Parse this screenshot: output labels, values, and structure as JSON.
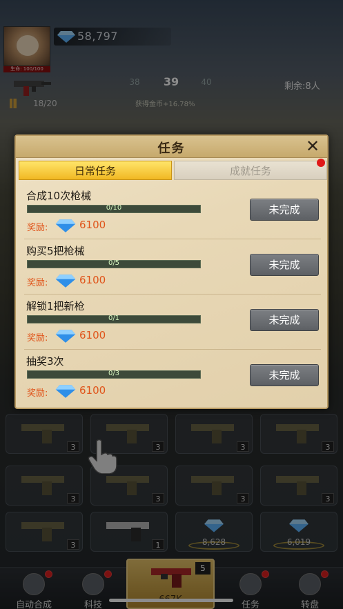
{
  "hud": {
    "gems": "58,797",
    "hp_label": "生命: 100/100",
    "ammo": "18/20",
    "level_prev": "38",
    "level_current": "39",
    "level_next": "40",
    "bonus": "获得金币+16.78%",
    "remaining": "剩余:8人"
  },
  "dialog": {
    "title": "任务",
    "close_label": "✕",
    "tabs": [
      {
        "label": "日常任务",
        "active": true
      },
      {
        "label": "成就任务",
        "active": false,
        "has_notification": true
      }
    ],
    "reward_label": "奖励:",
    "tasks": [
      {
        "title": "合成10次枪械",
        "progress_text": "0/10",
        "progress": 0,
        "reward": "6100",
        "status": "未完成"
      },
      {
        "title": "购买5把枪械",
        "progress_text": "0/5",
        "progress": 0,
        "reward": "6100",
        "status": "未完成"
      },
      {
        "title": "解锁1把新枪",
        "progress_text": "0/1",
        "progress": 0,
        "reward": "6100",
        "status": "未完成"
      },
      {
        "title": "抽奖3次",
        "progress_text": "0/3",
        "progress": 0,
        "reward": "6100",
        "status": "未完成"
      }
    ]
  },
  "grid": {
    "slot_levels": [
      "3",
      "3",
      "3",
      "3",
      "3",
      "3",
      "3",
      "3",
      "3",
      "1"
    ],
    "gem_slots": [
      "8,628",
      "6,019"
    ]
  },
  "bottom_nav": {
    "items": [
      {
        "label": "自动合成",
        "icon": "auto-merge-icon",
        "dot": true
      },
      {
        "label": "科技",
        "icon": "tech-icon",
        "dot": true
      },
      {
        "label": "任务",
        "icon": "task-icon",
        "dot": true
      },
      {
        "label": "转盘",
        "icon": "wheel-icon",
        "dot": true
      }
    ],
    "buy_level": "5",
    "buy_cost": "667K"
  },
  "colors": {
    "accent_gold": "#f1b823",
    "reward_orange": "#e0541a",
    "progress_green": "#7fc05a",
    "notification_red": "#e01818"
  }
}
